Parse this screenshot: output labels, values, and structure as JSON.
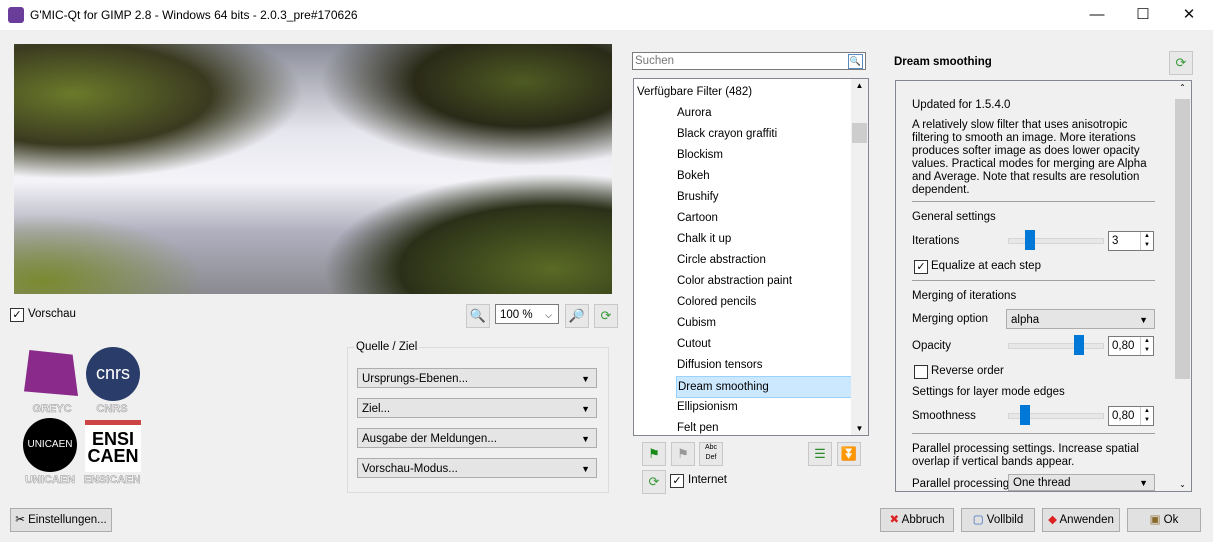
{
  "window": {
    "title": "G'MIC-Qt for GIMP 2.8 - Windows 64 bits - 2.0.3_pre#170626",
    "minimize": "—",
    "maximize": "☐",
    "close": "✕"
  },
  "preview": {
    "checkbox_label": "Vorschau",
    "checked": true,
    "zoom": "100 %"
  },
  "logos": [
    "GREYC",
    "CNRS",
    "UNICAEN",
    "ENSICAEN"
  ],
  "io": {
    "group_title": "Quelle  / Ziel",
    "input_layers": "Ursprungs-Ebenen...",
    "output": "Ziel...",
    "messages": "Ausgabe der Meldungen...",
    "preview_mode": "Vorschau-Modus..."
  },
  "settings_button": "Einstellungen...",
  "filters": {
    "search_placeholder": "Suchen",
    "header": "Verfügbare Filter (482)",
    "items": [
      "Aurora",
      "Black crayon graffiti",
      "Blockism",
      "Bokeh",
      "Brushify",
      "Cartoon",
      "Chalk it up",
      "Circle abstraction",
      "Color abstraction paint",
      "Colored pencils",
      "Cubism",
      "Cutout",
      "Diffusion tensors",
      "Dream smoothing",
      "Ellipsionism",
      "Felt pen"
    ],
    "selected": "Dream smoothing",
    "internet_label": "Internet",
    "internet_checked": true,
    "abc_label": "Abc Def"
  },
  "filter_panel": {
    "title": "Dream smoothing",
    "updated": "Updated for 1.5.4.0",
    "description": "A relatively slow filter that uses anisotropic filtering to smooth an image. More iterations produces softer image as does lower opacity values. Practical modes for merging are Alpha and Average. Note that results are resolution dependent.",
    "general_settings": "General settings",
    "iterations_label": "Iterations",
    "iterations": "3",
    "equalize_label": "Equalize at each step",
    "equalize": true,
    "merging_heading": "Merging of iterations",
    "merging_option_label": "Merging option",
    "merging_option": "alpha",
    "opacity_label": "Opacity",
    "opacity": "0,80",
    "reverse_label": "Reverse order",
    "reverse": false,
    "edges_heading": "Settings for layer mode edges",
    "smoothness_label": "Smoothness",
    "smoothness": "0,80",
    "parallel_text": "Parallel processing settings. Increase spatial overlap if vertical bands appear.",
    "parallel_label": "Parallel processing",
    "parallel_value": "One thread"
  },
  "buttons": {
    "cancel": "Abbruch",
    "fullscreen": "Vollbild",
    "apply": "Anwenden",
    "ok": "Ok"
  }
}
